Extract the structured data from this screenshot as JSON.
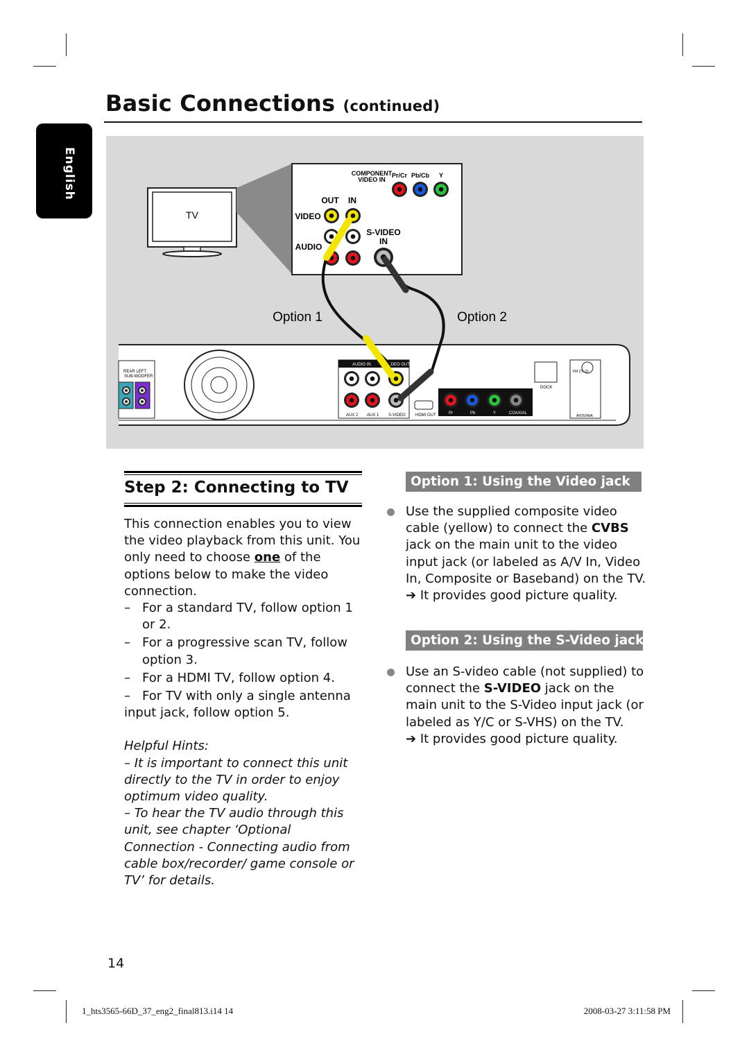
{
  "header": {
    "title": "Basic Connections",
    "subtitle": "(continued)"
  },
  "language_tab": "English",
  "diagram": {
    "tv_label": "TV",
    "option1_label": "Option 1",
    "option2_label": "Option 2",
    "tv_panel": {
      "component_label_1": "COMPONENT",
      "component_label_2": "VIDEO IN",
      "pr": "Pr/Cr",
      "pb": "Pb/Cb",
      "y": "Y",
      "out": "OUT",
      "in": "IN",
      "video": "VIDEO",
      "audio": "AUDIO",
      "svideo_1": "S-VIDEO",
      "svideo_2": "IN"
    },
    "unit_panel": {
      "rear_left": "REAR LEFT",
      "subwoofer": "SUB-WOOFER",
      "audio_in": "AUDIO IN",
      "video_out": "VIDEO OUT",
      "aux2": "AUX 2",
      "aux1": "AUX 1",
      "svideo": "S-VIDEO",
      "hdmi_out": "HDMI OUT",
      "pr": "Pr",
      "pb": "Pb",
      "y": "Y",
      "coaxial": "COAXIAL",
      "dock": "DOCK",
      "fm": "FM (75 Ω)",
      "antenna": "ANTENNA"
    },
    "colors": {
      "yellow": "#f2e600",
      "red": "#e8141c",
      "blue": "#1a5ae0",
      "green": "#2cc43a",
      "bg": "#d9d9d9"
    }
  },
  "step": {
    "title": "Step 2:  Connecting to TV",
    "intro_before": "This connection enables you to view the video playback from this unit. You only need to choose ",
    "intro_emph": "one",
    "intro_after": " of the options below to make the video connection.",
    "items": [
      "For a standard TV, follow option 1 or 2.",
      "For a progressive scan TV, follow option 3.",
      "For a HDMI TV, follow option 4.",
      "For TV with only a single antenna input jack, follow option 5."
    ],
    "hints_title": "Helpful Hints:",
    "hints": [
      "It is important to connect this unit directly to the TV in order to enjoy optimum video quality.",
      "To hear the TV audio through this unit, see chapter ‘Optional Connection - Connecting audio from cable box/recorder/ game console or TV’ for details."
    ]
  },
  "option1": {
    "title": "Option 1: Using the Video jack",
    "text_before": "Use the supplied composite video cable (yellow) to connect the ",
    "text_bold": "CVBS",
    "text_after": " jack on the main unit to the video input jack (or labeled as A/V In, Video In, Composite or Baseband) on the TV.",
    "result": "It provides good picture quality."
  },
  "option2": {
    "title": "Option 2: Using the S-Video jack",
    "text_before": "Use an S-video cable (not supplied) to connect the ",
    "text_bold": "S-VIDEO",
    "text_after": " jack on the main unit to the S-Video input jack (or labeled as Y/C or S-VHS) on the TV.",
    "result": "It provides good picture quality."
  },
  "page_number": "14",
  "footer": {
    "file": "1_hts3565-66D_37_eng2_final813.i14   14",
    "timestamp": "2008-03-27   3:11:58 PM"
  }
}
